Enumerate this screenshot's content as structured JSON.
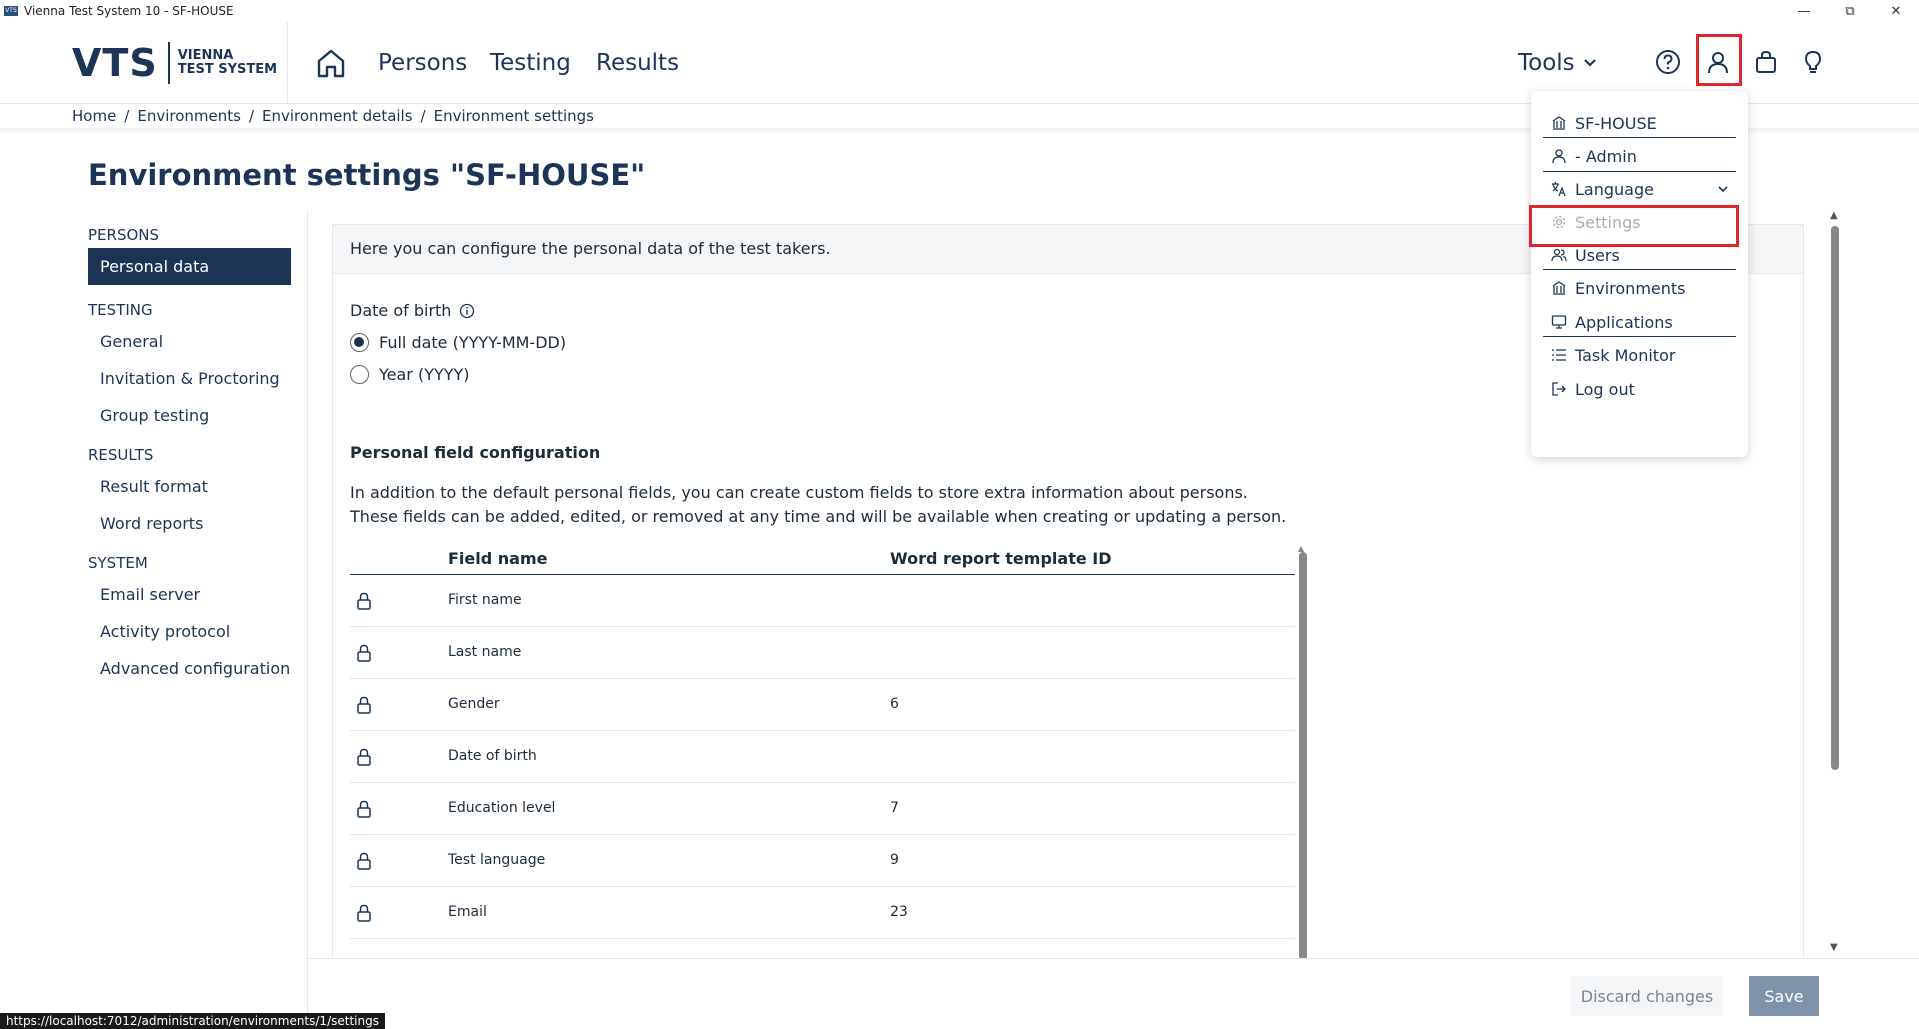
{
  "window": {
    "title": "Vienna Test System 10 - SF-HOUSE",
    "app_icon": "VTS"
  },
  "header": {
    "logo_main": "VTS",
    "logo_sub_line1": "VIENNA",
    "logo_sub_line2": "TEST SYSTEM",
    "nav": [
      "Persons",
      "Testing",
      "Results"
    ],
    "tools_label": "Tools"
  },
  "breadcrumb": [
    "Home",
    "/",
    "Environments",
    "/",
    "Environment details",
    "/",
    "Environment settings"
  ],
  "page": {
    "title": "Environment settings \"SF-HOUSE\""
  },
  "sidebar": {
    "sections": [
      {
        "title": "PERSONS",
        "items": [
          "Personal data"
        ]
      },
      {
        "title": "TESTING",
        "items": [
          "General",
          "Invitation & Proctoring",
          "Group testing"
        ]
      },
      {
        "title": "RESULTS",
        "items": [
          "Result format",
          "Word reports"
        ]
      },
      {
        "title": "SYSTEM",
        "items": [
          "Email server",
          "Activity protocol",
          "Advanced configuration"
        ]
      }
    ]
  },
  "content": {
    "intro": "Here you can configure the personal data of the test takers.",
    "dob_label": "Date of birth",
    "dob_options": [
      {
        "label": "Full date (YYYY-MM-DD)",
        "checked": true
      },
      {
        "label": "Year (YYYY)",
        "checked": false
      }
    ],
    "pfc_title": "Personal field configuration",
    "pfc_desc_line1": "In addition to the default personal fields, you can create custom fields to store extra information about persons.",
    "pfc_desc_line2": "These fields can be added, edited, or removed at any time and will be available when creating or updating a person.",
    "table": {
      "headers": [
        "Field name",
        "Word report template ID"
      ],
      "rows": [
        [
          "First name",
          ""
        ],
        [
          "Last name",
          ""
        ],
        [
          "Gender",
          "6"
        ],
        [
          "Date of birth",
          ""
        ],
        [
          "Education level",
          "7"
        ],
        [
          "Test language",
          "9"
        ],
        [
          "Email",
          "23"
        ]
      ]
    }
  },
  "footer": {
    "discard": "Discard changes",
    "save": "Save"
  },
  "status_url": "https://localhost:7012/administration/environments/1/settings",
  "user_menu": {
    "items": [
      {
        "label": "SF-HOUSE",
        "icon": "building-icon"
      },
      {
        "label": "- Admin",
        "icon": "user-icon"
      },
      {
        "label": "Language",
        "icon": "translate-icon"
      },
      {
        "label": "Settings",
        "icon": "gear-icon",
        "disabled": true
      },
      {
        "label": "Users",
        "icon": "users-icon"
      },
      {
        "label": "Environments",
        "icon": "building-icon"
      },
      {
        "label": "Applications",
        "icon": "monitor-icon"
      },
      {
        "label": "Task Monitor",
        "icon": "list-icon"
      },
      {
        "label": "Log out",
        "icon": "logout-icon"
      }
    ]
  },
  "colors": {
    "brand": "#1c3557",
    "highlight": "#e0262b",
    "save_button": "#7e93a8"
  }
}
